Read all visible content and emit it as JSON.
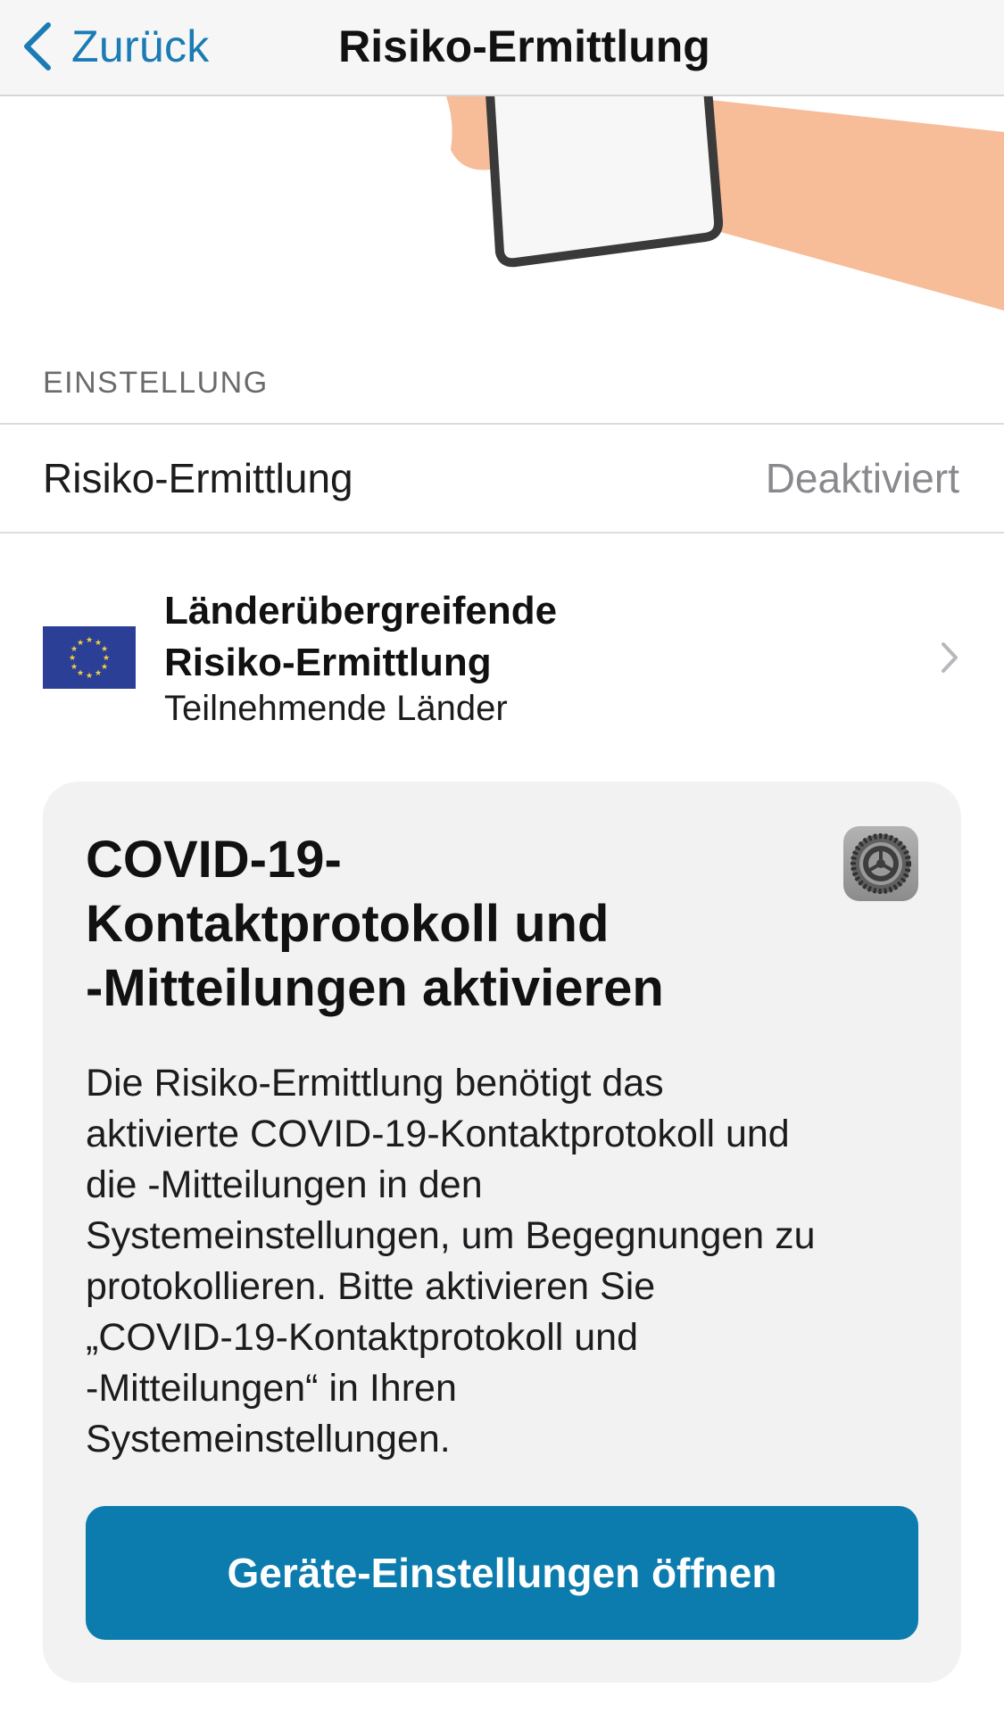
{
  "navbar": {
    "back_label": "Zurück",
    "title": "Risiko-Ermittlung"
  },
  "settings_section": {
    "header": "EINSTELLUNG",
    "row_label": "Risiko-Ermittlung",
    "row_value": "Deaktiviert"
  },
  "cross_border": {
    "title_line1": "Länderübergreifende",
    "title_line2": "Risiko-Ermittlung",
    "subtitle": "Teilnehmende Länder"
  },
  "card": {
    "title_line1": "COVID-19-",
    "title_line2": "Kontaktprotokoll und",
    "title_line3": "-Mitteilungen aktivieren",
    "body_lines": [
      "Die Risiko-Ermittlung benötigt das",
      "aktivierte COVID-19-Kontaktprotokoll und",
      "die -Mitteilungen in den",
      "Systemeinstellungen, um Begegnungen zu",
      "protokollieren. Bitte aktivieren Sie",
      "„COVID-19-Kontaktprotokoll und",
      "-Mitteilungen“ in Ihren",
      "Systemeinstellungen."
    ],
    "button_label": "Geräte-Einstellungen öffnen"
  },
  "icons": {
    "back": "chevron-left-icon",
    "disclosure": "chevron-right-icon",
    "flag": "eu-flag-icon",
    "settings": "gear-icon"
  },
  "colors": {
    "accent": "#1b7bb4",
    "button": "#0b7cad",
    "card_background": "#f2f2f2",
    "skin": "#f7bc98"
  }
}
